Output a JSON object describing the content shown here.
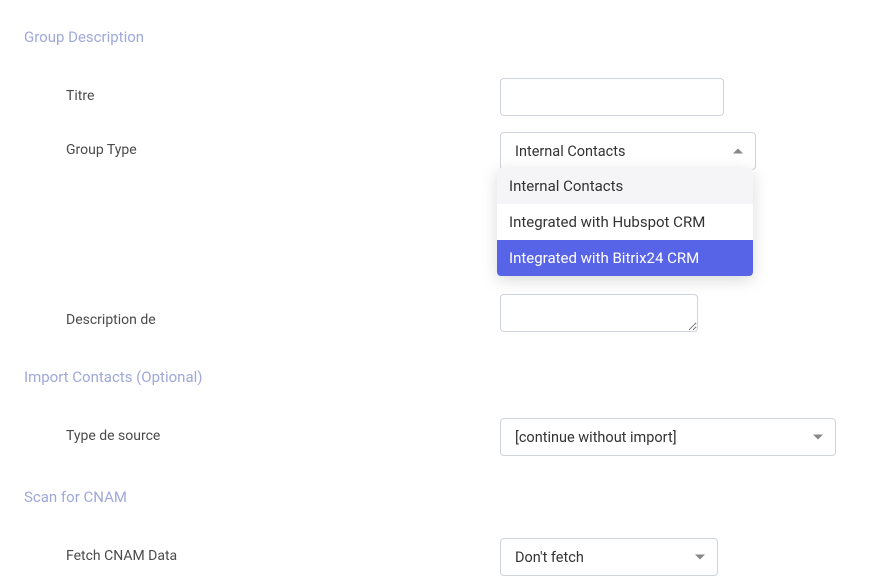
{
  "sections": {
    "groupDescription": {
      "title": "Group Description",
      "fields": {
        "titre": {
          "label": "Titre",
          "value": ""
        },
        "groupType": {
          "label": "Group Type",
          "selected": "Internal Contacts",
          "options": [
            "Internal Contacts",
            "Integrated with Hubspot CRM",
            "Integrated with Bitrix24 CRM"
          ]
        },
        "description": {
          "label": "Description de",
          "value": ""
        }
      }
    },
    "importContacts": {
      "title": "Import Contacts (Optional)",
      "fields": {
        "sourceType": {
          "label": "Type de source",
          "selected": "[continue without import]"
        }
      }
    },
    "scanCnam": {
      "title": "Scan for CNAM",
      "fields": {
        "fetchCnam": {
          "label": "Fetch CNAM Data",
          "selected": "Don't fetch"
        }
      }
    }
  }
}
